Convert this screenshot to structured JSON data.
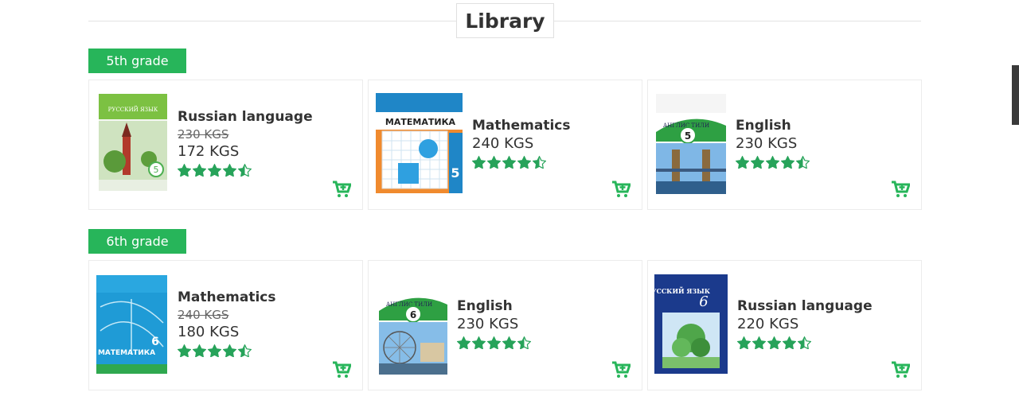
{
  "page": {
    "title": "Library"
  },
  "colors": {
    "accent": "#27b55a",
    "star": "#27a35a",
    "text": "#333333"
  },
  "sections": [
    {
      "grade": "5th grade",
      "books": [
        {
          "name": "Russian language",
          "old_price": "230 KGS",
          "price": "172 KGS",
          "rating": 4.5,
          "cover_text": "РУССКИЙ ЯЗЫК",
          "cover_mark": "5"
        },
        {
          "name": "Mathematics",
          "old_price": "",
          "price": "240 KGS",
          "rating": 4.5,
          "cover_text": "МАТЕМАТИКА",
          "cover_mark": "5"
        },
        {
          "name": "English",
          "old_price": "",
          "price": "230 KGS",
          "rating": 4.5,
          "cover_text": "АНГЛИС ТИЛИ",
          "cover_mark": "5"
        }
      ]
    },
    {
      "grade": "6th grade",
      "books": [
        {
          "name": "Mathematics",
          "old_price": "240 KGS",
          "price": "180 KGS",
          "rating": 4.5,
          "cover_text": "МАТЕМАТИКА",
          "cover_mark": "6"
        },
        {
          "name": "English",
          "old_price": "",
          "price": "230 KGS",
          "rating": 4.5,
          "cover_text": "АНГЛИС ТИЛИ",
          "cover_mark": "6"
        },
        {
          "name": "Russian language",
          "old_price": "",
          "price": "220 KGS",
          "rating": 4.5,
          "cover_text": "РУССКИЙ ЯЗЫК",
          "cover_mark": "6"
        }
      ]
    }
  ],
  "icons": {
    "cart": "add-to-cart-icon",
    "star": "star-icon",
    "half_star": "half-star-icon"
  }
}
